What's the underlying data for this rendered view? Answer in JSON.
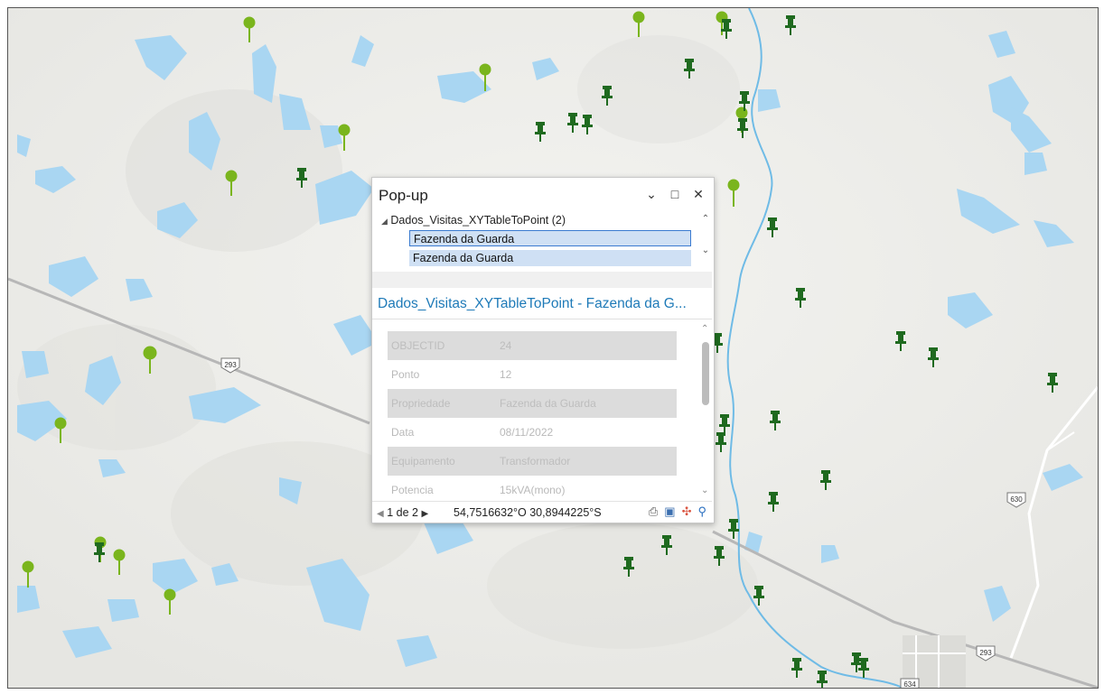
{
  "popup": {
    "title": "Pop-up",
    "layer_node": "Dados_Visitas_XYTableToPoint (2)",
    "items": [
      "Fazenda da Guarda",
      "Fazenda da Guarda"
    ],
    "feature_title": "Dados_Visitas_XYTableToPoint - Fazenda da G...",
    "attributes": [
      {
        "field": "OBJECTID",
        "value": "24"
      },
      {
        "field": "Ponto",
        "value": "12"
      },
      {
        "field": "Propriedade",
        "value": "Fazenda da Guarda"
      },
      {
        "field": "Data",
        "value": "08/11/2022"
      },
      {
        "field": "Equipamento",
        "value": "Transformador"
      },
      {
        "field": "Potencia",
        "value": "15kVA(mono)"
      }
    ],
    "nav": {
      "current": "1",
      "of_label": "de",
      "total": "2"
    },
    "coordinates": "54,7516632°O 30,8944225°S"
  },
  "map": {
    "road_shields": [
      "293",
      "630",
      "293",
      "634"
    ],
    "colors": {
      "water": "#a9d6f2",
      "pin_dark": "#1f6a1f",
      "pin_light": "#7ab51d",
      "road": "#bcbcbc",
      "river": "#6fbbe6"
    }
  }
}
